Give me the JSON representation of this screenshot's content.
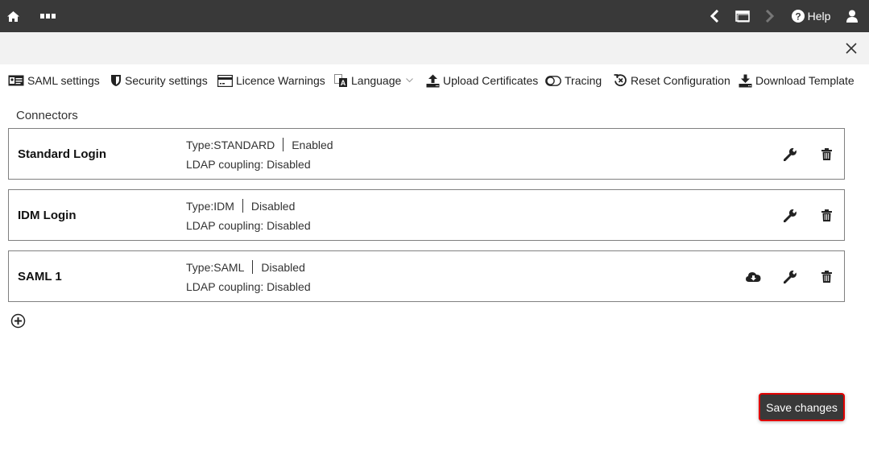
{
  "topbar": {
    "home_icon": "home-icon",
    "more_icon": "more-icon",
    "back_icon": "chevron-left-icon",
    "window_icon": "window-icon",
    "forward_icon": "chevron-right-icon",
    "help_label": "Help",
    "user_icon": "user-icon"
  },
  "subbar": {
    "close_icon": "close-icon"
  },
  "toolbar": {
    "items": [
      {
        "label": "SAML settings",
        "icon": "id-card-icon"
      },
      {
        "label": "Security settings",
        "icon": "shield-icon"
      },
      {
        "label": "Licence Warnings",
        "icon": "credit-card-icon"
      },
      {
        "label": "Language",
        "icon": "language-icon",
        "dropdown": true
      },
      {
        "label": "Upload Certificates",
        "icon": "upload-icon"
      },
      {
        "label": "Tracing",
        "icon": "toggle-off-icon"
      },
      {
        "label": "Reset Configuration",
        "icon": "history-reset-icon"
      },
      {
        "label": "Download Template",
        "icon": "download-icon"
      }
    ]
  },
  "main": {
    "section_title": "Connectors",
    "connectors": [
      {
        "name": "Standard Login",
        "type": "Type:STANDARD",
        "status": "Enabled",
        "ldap": "LDAP coupling: Disabled",
        "has_cloud_download": false
      },
      {
        "name": "IDM Login",
        "type": "Type:IDM",
        "status": "Disabled",
        "ldap": "LDAP coupling: Disabled",
        "has_cloud_download": false
      },
      {
        "name": "SAML 1",
        "type": "Type:SAML",
        "status": "Disabled",
        "ldap": "LDAP coupling: Disabled",
        "has_cloud_download": true
      }
    ],
    "add_icon": "plus-circle-icon"
  },
  "footer": {
    "save_label": "Save changes"
  },
  "colors": {
    "topbar_bg": "#393939",
    "subbar_bg": "#f2f2f2",
    "save_border": "#e00000"
  }
}
